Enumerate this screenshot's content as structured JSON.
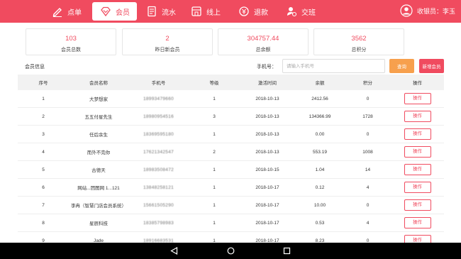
{
  "nav": {
    "items": [
      {
        "label": "点单",
        "icon": "pen-icon"
      },
      {
        "label": "会员",
        "icon": "diamond-icon",
        "active": true
      },
      {
        "label": "流水",
        "icon": "ledger-icon"
      },
      {
        "label": "线上",
        "icon": "shop-icon"
      },
      {
        "label": "退款",
        "icon": "refund-icon"
      },
      {
        "label": "交班",
        "icon": "handover-icon"
      }
    ],
    "user_label": "收银员：李玉"
  },
  "stats": [
    {
      "value": "103",
      "label": "会员总数"
    },
    {
      "value": "2",
      "label": "昨日新会员"
    },
    {
      "value": "304757.44",
      "label": "总余额"
    },
    {
      "value": "3562",
      "label": "总积分"
    }
  ],
  "filter": {
    "section_title": "会员信息",
    "phone_label": "手机号：",
    "phone_placeholder": "请输入手机号",
    "query_button": "查询",
    "add_button": "新增会员"
  },
  "table": {
    "headers": [
      "序号",
      "会员名称",
      "手机号",
      "等级",
      "激活时间",
      "余额",
      "积分",
      "操作"
    ],
    "rows": [
      [
        "1",
        "大梦想家",
        "18993479660",
        "1",
        "2018-10-13",
        "2412.56",
        "0",
        "操作"
      ],
      [
        "2",
        "五五付星先生",
        "18980954516",
        "3",
        "2018-10-13",
        "134366.99",
        "1728",
        "操作"
      ],
      [
        "3",
        "任后余生",
        "18369595180",
        "1",
        "2018-10-13",
        "0.00",
        "0",
        "操作"
      ],
      [
        "4",
        "而外不完你",
        "17621342547",
        "2",
        "2018-10-13",
        "553.19",
        "1008",
        "操作"
      ],
      [
        "5",
        "古德天",
        "18983508472",
        "1",
        "2018-10-15",
        "1.04",
        "14",
        "操作"
      ],
      [
        "6",
        "网站...团图网 1...121",
        "13848258121",
        "1",
        "2018-10-17",
        "0.12",
        "4",
        "操作"
      ],
      [
        "7",
        "李冉（智慧门店会员系统）",
        "15661505290",
        "1",
        "2018-10-17",
        "10.00",
        "0",
        "操作"
      ],
      [
        "8",
        "星辰科技",
        "18385798983",
        "1",
        "2018-10-17",
        "0.53",
        "4",
        "操作"
      ],
      [
        "9",
        "Jade",
        "18916683531",
        "1",
        "2018-10-17",
        "8.23",
        "0",
        "操作"
      ]
    ]
  },
  "colors": {
    "brand": "#f04b5f",
    "query": "#f7a04d",
    "header_bg": "#f2f2f2"
  }
}
